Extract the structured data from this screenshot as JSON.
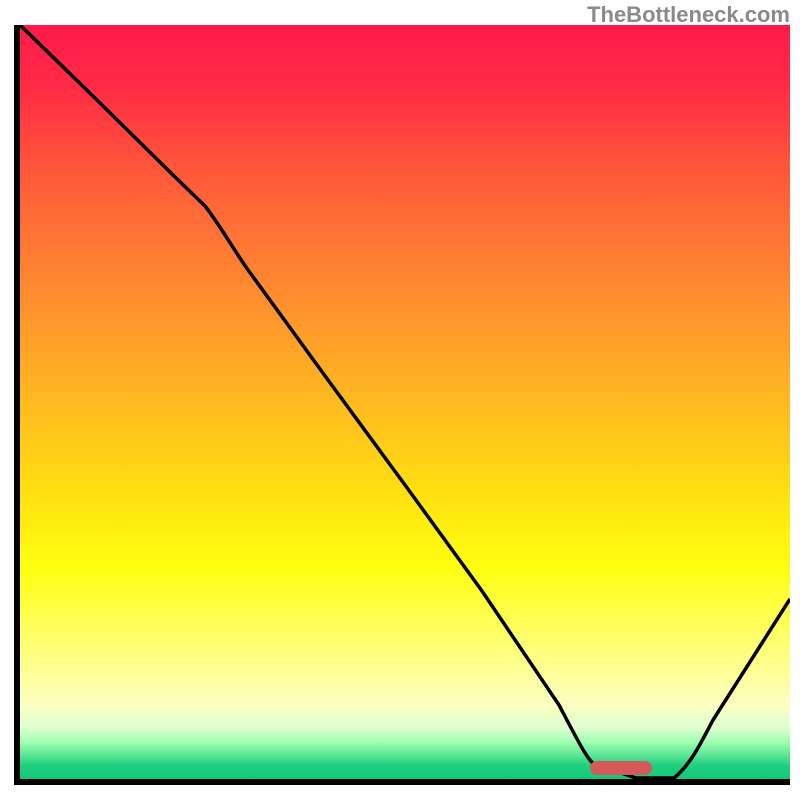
{
  "watermark": "TheBottleneck.com",
  "chart_data": {
    "type": "line",
    "title": "",
    "xlabel": "",
    "ylabel": "",
    "xlim": [
      0,
      100
    ],
    "ylim": [
      0,
      100
    ],
    "background_gradient": {
      "top_color": "#ff1a4a",
      "mid_color": "#ffff10",
      "bottom_color": "#10c878",
      "description": "vertical gradient red-orange-yellow-green representing bottleneck severity"
    },
    "series": [
      {
        "name": "bottleneck-curve",
        "x": [
          0,
          10,
          20,
          24,
          30,
          40,
          50,
          60,
          70,
          75,
          80,
          85,
          90,
          100
        ],
        "y": [
          100,
          90,
          80,
          76,
          67,
          53,
          39,
          25,
          10,
          2,
          0,
          0,
          8,
          24
        ]
      }
    ],
    "marker": {
      "x_start": 75,
      "x_end": 83,
      "y": 1,
      "color": "#d45a5a",
      "shape": "rounded-bar"
    }
  }
}
